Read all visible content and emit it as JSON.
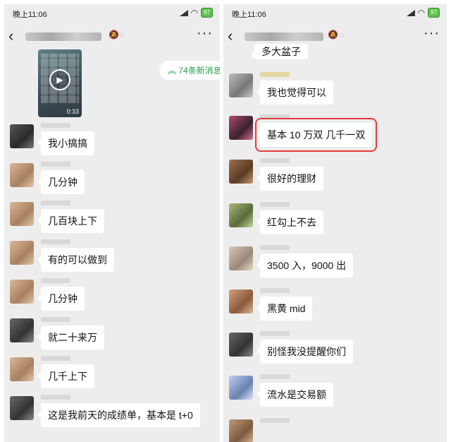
{
  "left": {
    "status_time": "晚上11:06",
    "battery": "97",
    "new_messages": "74条新消息",
    "video_duration": "0:33",
    "messages": [
      {
        "text": "我小搞搞",
        "avatar": "#3a3a3a"
      },
      {
        "text": "几分钟",
        "avatar": "#c09a7a"
      },
      {
        "text": "几百块上下",
        "avatar": "#c09a7a"
      },
      {
        "text": "有的可以做到",
        "avatar": "#c09a7a"
      },
      {
        "text": "几分钟",
        "avatar": "#c09a7a"
      },
      {
        "text": "就二十来万",
        "avatar": "#4a4a4a"
      },
      {
        "text": "几千上下",
        "avatar": "#c09a7a"
      },
      {
        "text": "这是我前天的成绩单，基本是 t+0",
        "avatar": "#4a4a4a"
      }
    ]
  },
  "right": {
    "status_time": "晚上11:06",
    "battery": "97",
    "top_partial": "多大盆子",
    "messages": [
      {
        "text": "我也觉得可以",
        "avatar": "#8a8a8a"
      },
      {
        "text": "基本 10 万双   几千一双",
        "avatar": "#8a3a5a",
        "highlight": true
      },
      {
        "text": "很好的理财",
        "avatar": "#7a5a40"
      },
      {
        "text": "红勾上不去",
        "avatar": "#8a9a6a"
      },
      {
        "text": "3500 入，9000 出",
        "avatar": "#b0a090"
      },
      {
        "text": "黑黄 mid",
        "avatar": "#b88a6a"
      },
      {
        "text": "别怪我没提醒你们",
        "avatar": "#4a4a4a"
      },
      {
        "text": "流水是交易额",
        "avatar": "#8aa0c8"
      }
    ]
  },
  "colors": {
    "accent_green": "#2aa04a",
    "highlight_red": "#e23c3c",
    "background": "#ededed"
  }
}
